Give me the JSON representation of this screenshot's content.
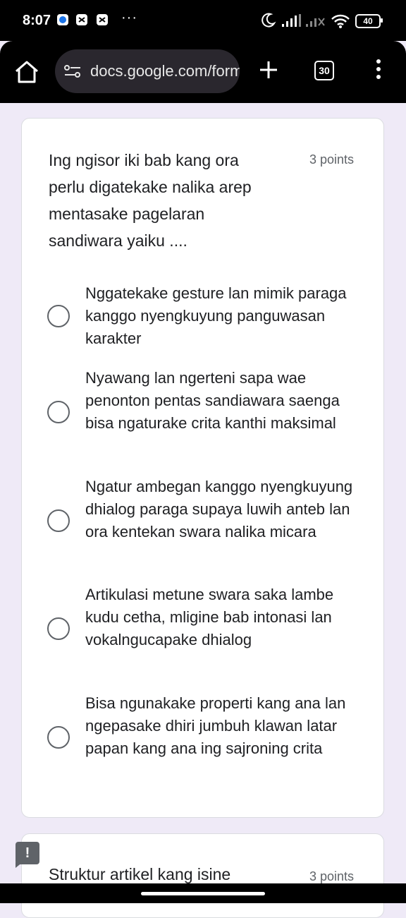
{
  "status_bar": {
    "time": "8:07",
    "more": "···",
    "battery": "40"
  },
  "browser": {
    "url": "docs.google.com/forms",
    "tab_count": "30"
  },
  "question1": {
    "text": "Ing ngisor iki bab kang ora perlu digatekake nalika arep mentasake pagelaran sandiwara yaiku ....",
    "points": "3 points",
    "options": [
      "Nggatekake gesture lan mimik paraga kanggo nyengkuyung panguwasan karakter",
      "Nyawang lan ngerteni sapa wae penonton pentas sandiawara saenga bisa ngaturake crita kanthi maksimal",
      "Ngatur ambegan kanggo nyengkuyung dhialog paraga supaya luwih anteb lan ora kentekan swara nalika micara",
      "Artikulasi metune swara saka lambe kudu cetha, mligine bab intonasi lan vokalngucapake dhialog",
      "Bisa ngunakake properti kang ana lan ngepasake dhiri jumbuh klawan latar papan kang ana ing sajroning crita"
    ]
  },
  "question2": {
    "text": "Struktur artikel kang isine",
    "points": "3 points"
  },
  "feedback": {
    "label": "!"
  }
}
